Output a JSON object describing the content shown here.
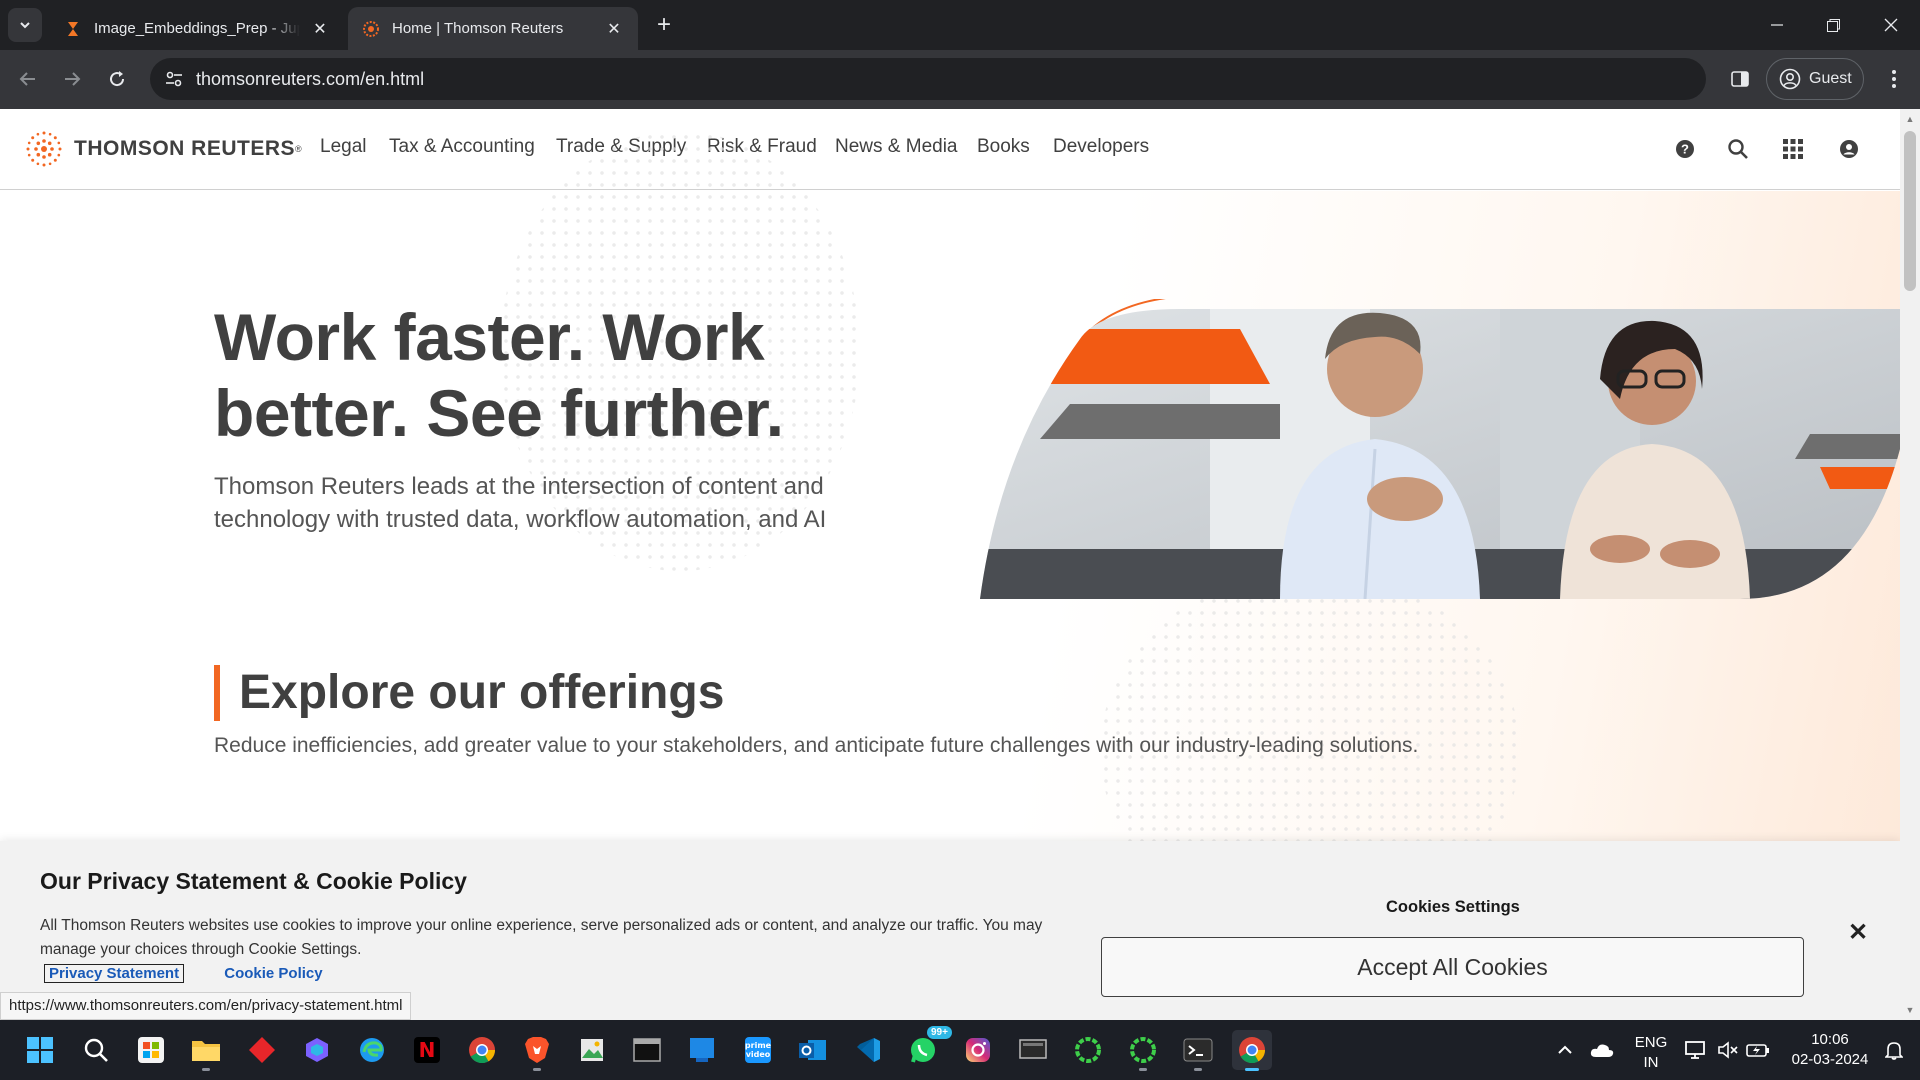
{
  "browser": {
    "tabs": [
      {
        "title": "Image_Embeddings_Prep - Jupyter",
        "active": false
      },
      {
        "title": "Home | Thomson Reuters",
        "active": true
      }
    ],
    "url": "thomsonreuters.com/en.html",
    "profile_label": "Guest"
  },
  "site": {
    "logo_text": "THOMSON REUTERS",
    "logo_mark": "®",
    "nav": [
      "Legal",
      "Tax & Accounting",
      "Trade & Supply",
      "Risk & Fraud",
      "News & Media",
      "Books",
      "Developers"
    ],
    "header_icons": [
      "help-icon",
      "search-icon",
      "apps-grid-icon",
      "account-icon"
    ]
  },
  "hero": {
    "title": "Work faster. Work better. See further.",
    "subtitle": "Thomson Reuters leads at the intersection of content and technology with trusted data, workflow automation, and AI"
  },
  "offerings": {
    "title": "Explore our offerings",
    "subtitle": "Reduce inefficiencies, add greater value to your stakeholders, and anticipate future challenges with our industry-leading solutions.",
    "cards": [
      {
        "icon": "gavel-icon"
      },
      {
        "icon": "ledger-icon"
      },
      {
        "icon": "globe-search-icon"
      },
      {
        "icon": "risk-gauge-icon"
      },
      {
        "icon": "document-icon"
      }
    ]
  },
  "cookie_banner": {
    "title": "Our Privacy Statement & Cookie Policy",
    "text": "All Thomson Reuters websites use cookies to improve your online experience, serve personalized ads or content, and analyze our traffic. You may manage your choices through Cookie Settings.",
    "links": [
      "Privacy Statement",
      "Cookie Policy"
    ],
    "settings_label": "Cookies Settings",
    "accept_label": "Accept All Cookies",
    "close_label": "✕"
  },
  "status_url": "https://www.thomsonreuters.com/en/privacy-statement.html",
  "taskbar": {
    "apps": [
      "windows-start",
      "search",
      "microsoft-store",
      "file-explorer",
      "app-red",
      "copilot",
      "edge",
      "netflix",
      "chrome",
      "brave",
      "image-viewer",
      "terminal-dark",
      "window-app",
      "prime-video",
      "outlook",
      "vscode",
      "whatsapp",
      "instagram",
      "desktop-app",
      "green-app-1",
      "green-app-2",
      "terminal",
      "chrome-active"
    ],
    "whatsapp_badge": "99+",
    "language": "ENG",
    "region": "IN",
    "time": "10:06",
    "date": "02-03-2024"
  },
  "colors": {
    "accent_orange": "#f26722",
    "chrome_dark": "#202124",
    "chrome_toolbar": "#35363a",
    "taskbar": "#1c1f26"
  }
}
